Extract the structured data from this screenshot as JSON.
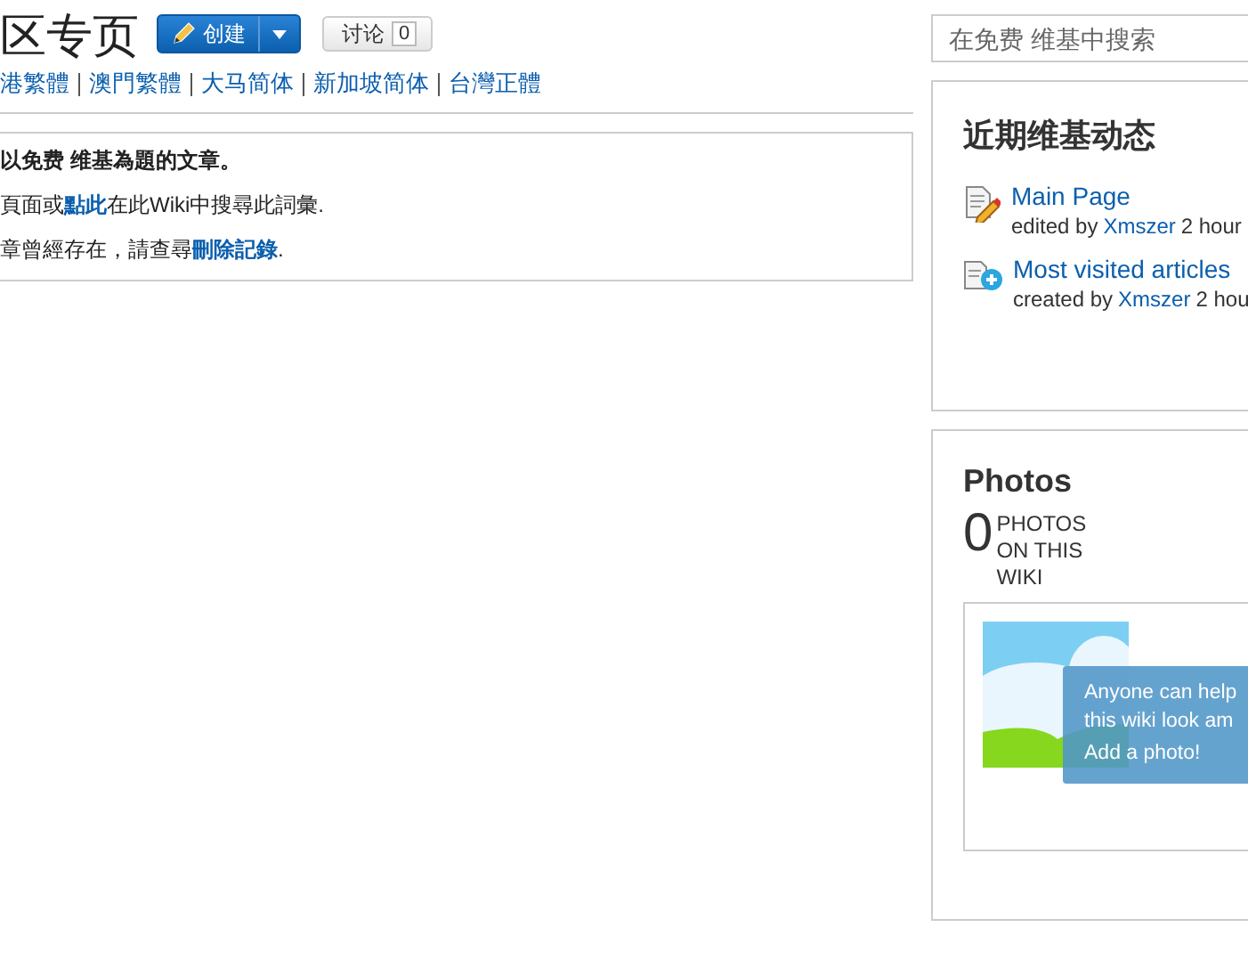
{
  "header": {
    "title": "区专页",
    "create_button": "创建",
    "discuss_button": {
      "label": "讨论",
      "count": "0"
    }
  },
  "variants": [
    "港繁體",
    "澳門繁體",
    "大马简体",
    "新加坡简体",
    "台灣正體"
  ],
  "notice": [
    {
      "before": "以免费 维基為題的文章。",
      "bold": true
    },
    {
      "before": "頁面或",
      "link": "點此",
      "after": "在此Wiki中搜尋此詞彙.",
      "bold": false
    },
    {
      "before": "章曾經存在，請查尋",
      "link": "刪除記錄",
      "after": ".",
      "bold": false
    }
  ],
  "search": {
    "placeholder": "在免费 维基中搜索"
  },
  "activity": {
    "title": "近期维基动态",
    "items": [
      {
        "kind": "edit",
        "title": "Main Page",
        "verb": "edited by",
        "user": "Xmszer",
        "time": "2 hour"
      },
      {
        "kind": "create",
        "title": "Most visited articles",
        "verb": "created by",
        "user": "Xmszer",
        "time": "2 hou"
      }
    ]
  },
  "photos": {
    "title": "Photos",
    "count": "0",
    "count_label": "PHOTOS ON THIS WIKI",
    "tooltip": {
      "lines": [
        "Anyone can help",
        "this wiki look am"
      ],
      "link": "Add a photo!"
    }
  }
}
